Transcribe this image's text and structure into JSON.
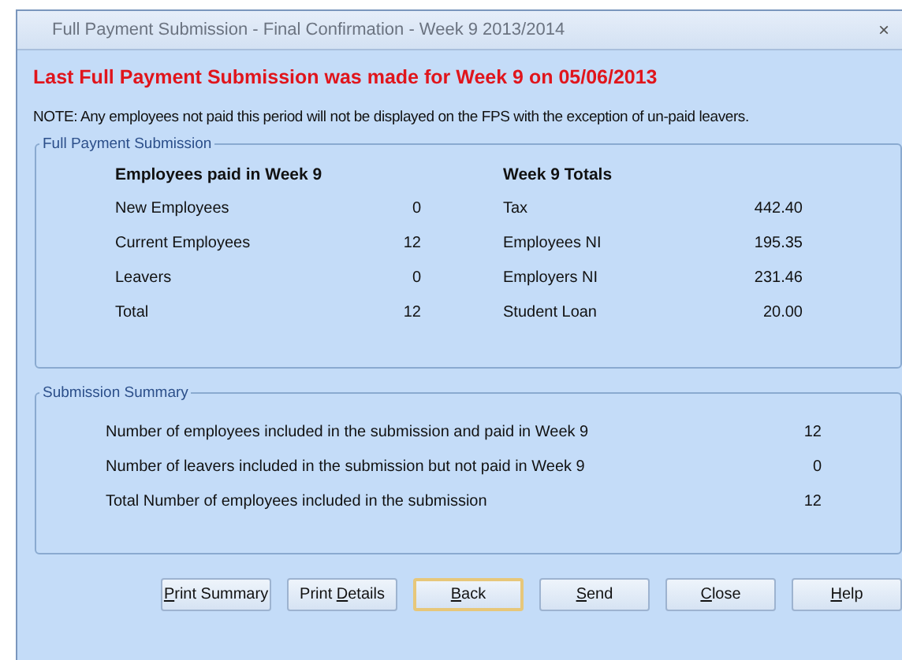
{
  "window": {
    "title": "Full Payment Submission - Final Confirmation - Week 9 2013/2014",
    "close_glyph": "×"
  },
  "heading": "Last Full Payment Submission was made for Week 9 on 05/06/2013",
  "note": "NOTE: Any employees not paid this period will not be displayed on the FPS with the exception of un-paid leavers.",
  "fps_group": {
    "title": "Full Payment Submission",
    "employees": {
      "heading": "Employees paid in Week 9",
      "rows": [
        {
          "label": "New Employees",
          "value": "0"
        },
        {
          "label": "Current Employees",
          "value": "12"
        },
        {
          "label": "Leavers",
          "value": "0"
        },
        {
          "label": "Total",
          "value": "12"
        }
      ]
    },
    "totals": {
      "heading": "Week 9 Totals",
      "rows": [
        {
          "label": "Tax",
          "value": "442.40"
        },
        {
          "label": "Employees NI",
          "value": "195.35"
        },
        {
          "label": "Employers NI",
          "value": "231.46"
        },
        {
          "label": "Student Loan",
          "value": "20.00"
        }
      ]
    }
  },
  "summary_group": {
    "title": "Submission Summary",
    "rows": [
      {
        "label": "Number of employees included in the submission and paid in Week 9",
        "value": "12"
      },
      {
        "label": "Number of leavers included in the submission but not paid in Week 9",
        "value": "0"
      },
      {
        "label": "Total Number of employees included in the submission",
        "value": "12"
      }
    ]
  },
  "buttons": [
    {
      "access_key": "P",
      "label_rest": "rint Summary",
      "focused": false
    },
    {
      "label_start": "Print ",
      "access_key": "D",
      "label_rest": "etails",
      "focused": false
    },
    {
      "access_key": "B",
      "label_rest": "ack",
      "focused": true
    },
    {
      "access_key": "S",
      "label_rest": "end",
      "focused": false
    },
    {
      "access_key": "C",
      "label_rest": "lose",
      "focused": false
    },
    {
      "access_key": "H",
      "label_rest": "elp",
      "focused": false
    }
  ]
}
